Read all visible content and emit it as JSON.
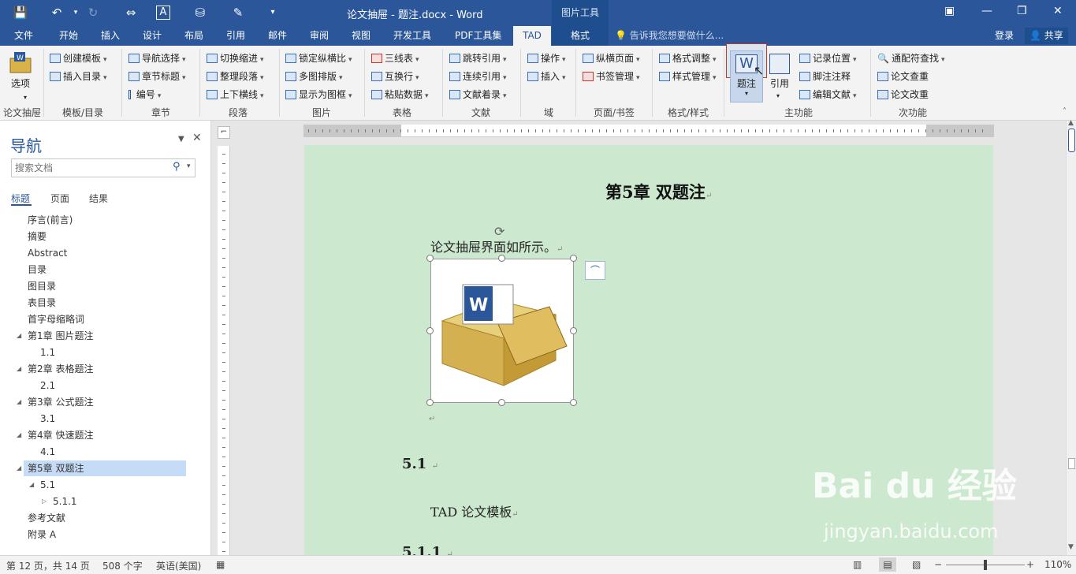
{
  "titlebar": {
    "doc_title": "论文抽屉 - 题注.docx - Word",
    "context_tool": "图片工具"
  },
  "tabs": [
    "文件",
    "开始",
    "插入",
    "设计",
    "布局",
    "引用",
    "邮件",
    "审阅",
    "视图",
    "开发工具",
    "PDF工具集",
    "TAD",
    "格式"
  ],
  "tellme": "告诉我您想要做什么...",
  "login": "登录",
  "share": "共享",
  "ribbon": {
    "options": "选项",
    "create_template": "创建模板",
    "insert_toc": "插入目录",
    "nav_select": "导航选择",
    "chapter_title": "章节标题",
    "numbering": "编号",
    "toggle_indent": "切换缩进",
    "arrange_para": "整理段落",
    "top_bottom_line": "上下横线",
    "lock_ratio": "锁定纵横比",
    "multi_fig": "多图排版",
    "show_frame": "显示为图框",
    "three_line": "三线表",
    "swap_row": "互换行",
    "paste_data": "粘贴数据",
    "jump_ref": "跳转引用",
    "cont_ref": "连续引用",
    "ref_list": "文献着录",
    "operate": "操作",
    "insert": "插入",
    "landscape": "纵横页面",
    "bookmark_mgmt": "书签管理",
    "format_adjust": "格式调整",
    "style_mgmt": "样式管理",
    "caption": "题注",
    "citation": "引用",
    "record_pos": "记录位置",
    "footnote": "脚注注释",
    "edit_ref": "编辑文献",
    "wildcard": "通配符查找",
    "dup_check": "论文查重",
    "paper_edit": "论文改重",
    "groups": [
      "论文抽屉",
      "模板/目录",
      "章节",
      "段落",
      "图片",
      "表格",
      "文献",
      "域",
      "页面/书签",
      "格式/样式",
      "主功能",
      "次功能"
    ]
  },
  "nav": {
    "title": "导航",
    "search_placeholder": "搜索文档",
    "tabs": [
      "标题",
      "页面",
      "结果"
    ],
    "headings": [
      {
        "text": "序言(前言)",
        "level": 1,
        "expand": ""
      },
      {
        "text": "摘要",
        "level": 1,
        "expand": ""
      },
      {
        "text": "Abstract",
        "level": 1,
        "expand": ""
      },
      {
        "text": "目录",
        "level": 1,
        "expand": ""
      },
      {
        "text": "图目录",
        "level": 1,
        "expand": ""
      },
      {
        "text": "表目录",
        "level": 1,
        "expand": ""
      },
      {
        "text": "首字母缩略词",
        "level": 1,
        "expand": ""
      },
      {
        "text": "第1章 图片题注",
        "level": 1,
        "expand": "◢"
      },
      {
        "text": "1.1",
        "level": 2,
        "expand": ""
      },
      {
        "text": "第2章 表格题注",
        "level": 1,
        "expand": "◢"
      },
      {
        "text": "2.1",
        "level": 2,
        "expand": ""
      },
      {
        "text": "第3章 公式题注",
        "level": 1,
        "expand": "◢"
      },
      {
        "text": "3.1",
        "level": 2,
        "expand": ""
      },
      {
        "text": "第4章 快速题注",
        "level": 1,
        "expand": "◢"
      },
      {
        "text": "4.1",
        "level": 2,
        "expand": ""
      },
      {
        "text": "第5章 双题注",
        "level": 1,
        "expand": "◢",
        "selected": true
      },
      {
        "text": "5.1",
        "level": 2,
        "expand": "◢"
      },
      {
        "text": "5.1.1",
        "level": 3,
        "expand": "▷"
      },
      {
        "text": "参考文献",
        "level": 1,
        "expand": ""
      },
      {
        "text": "附录 A",
        "level": 1,
        "expand": ""
      }
    ]
  },
  "document": {
    "chapter_title": "第5章 双题注",
    "para": "论文抽屉界面如所示。",
    "sec51": "5.1",
    "tad_text": "TAD 论文模板",
    "sec511": "5.1.1",
    "para_mark": "↵"
  },
  "status": {
    "page": "第 12 页，共 14 页",
    "words": "508 个字",
    "lang": "英语(美国)",
    "zoom": "110%"
  },
  "watermark": {
    "logo": "Bai du 经验",
    "url": "jingyan.baidu.com"
  }
}
